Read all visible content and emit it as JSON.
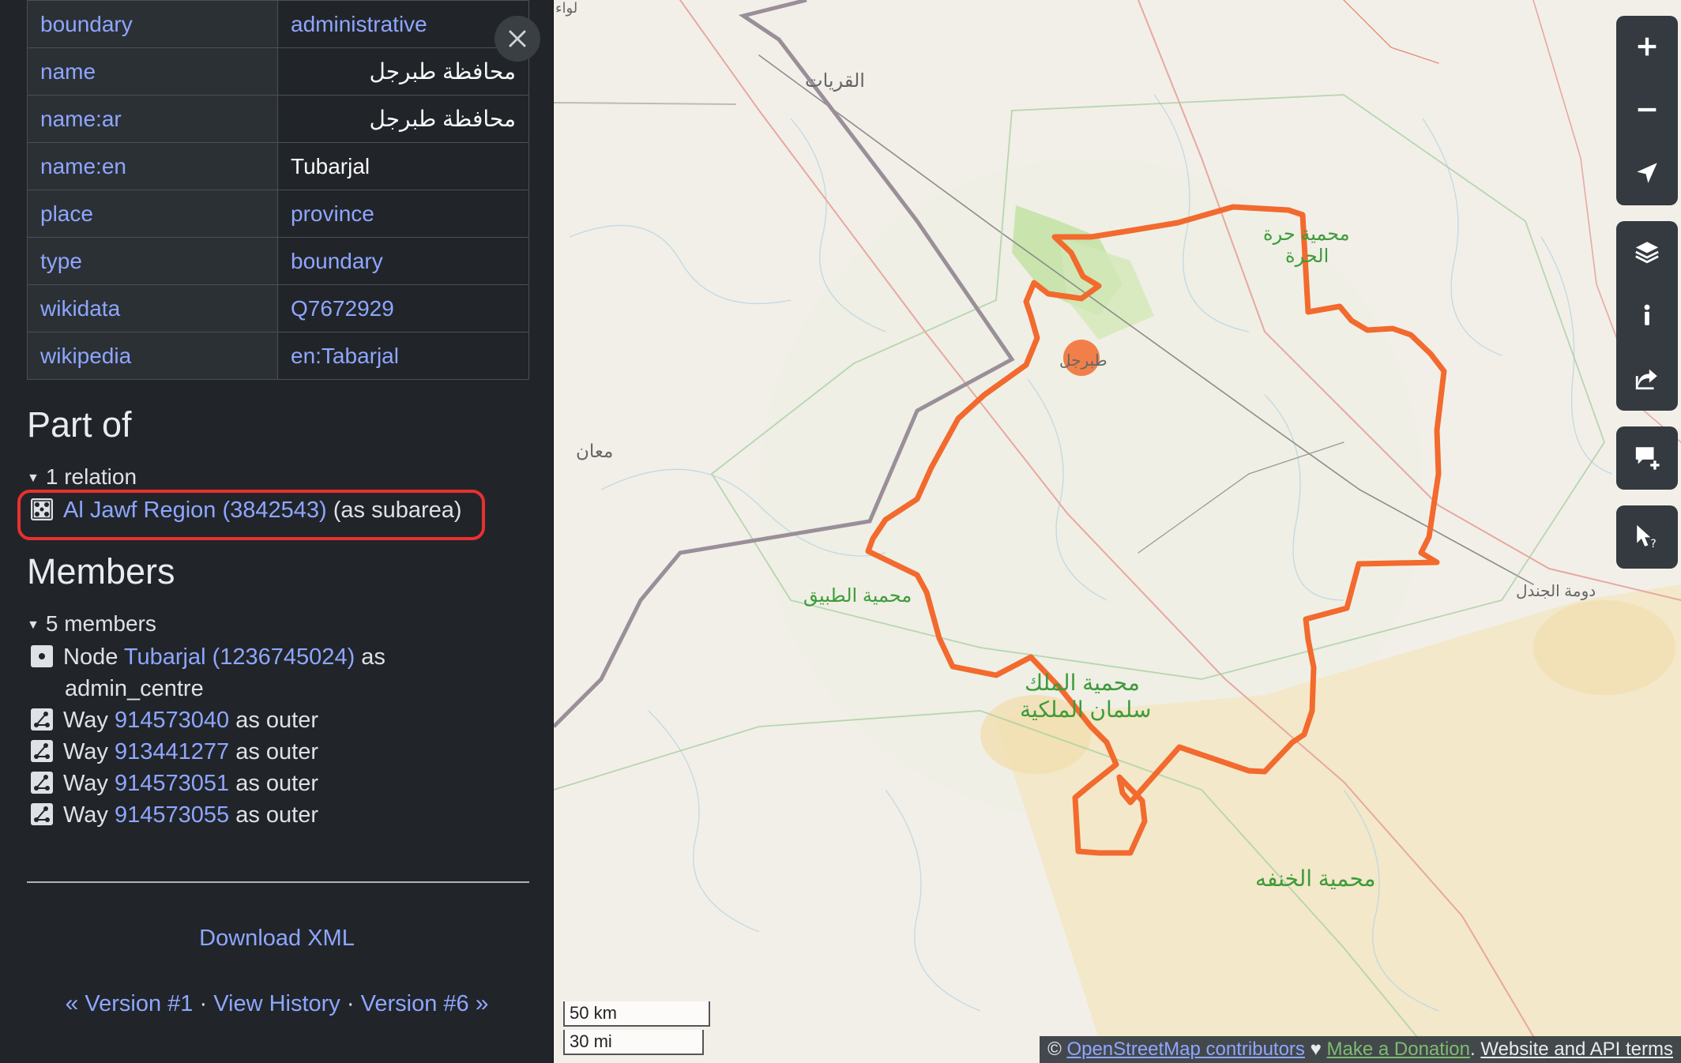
{
  "tags": [
    {
      "key": "boundary",
      "value": "administrative",
      "style": "link"
    },
    {
      "key": "name",
      "value": "محافظة طبرجل",
      "style": "rtl"
    },
    {
      "key": "name:ar",
      "value": "محافظة طبرجل",
      "style": "rtl"
    },
    {
      "key": "name:en",
      "value": "Tubarjal",
      "style": "plain"
    },
    {
      "key": "place",
      "value": "province",
      "style": "link"
    },
    {
      "key": "type",
      "value": "boundary",
      "style": "link"
    },
    {
      "key": "wikidata",
      "value": "Q7672929",
      "style": "link"
    },
    {
      "key": "wikipedia",
      "value": "en:Tabarjal",
      "style": "link"
    }
  ],
  "part_of": {
    "heading": "Part of",
    "summary": "1 relation",
    "relation_link": "Al Jawf Region (3842543)",
    "relation_suffix": "(as subarea)"
  },
  "members": {
    "heading": "Members",
    "summary": "5 members",
    "node": {
      "prefix": "Node",
      "link": "Tubarjal (1236745024)",
      "suffix": "as",
      "role": "admin_centre"
    },
    "ways": [
      {
        "prefix": "Way",
        "link": "914573040",
        "suffix": "as outer"
      },
      {
        "prefix": "Way",
        "link": "913441277",
        "suffix": "as outer"
      },
      {
        "prefix": "Way",
        "link": "914573051",
        "suffix": "as outer"
      },
      {
        "prefix": "Way",
        "link": "914573055",
        "suffix": "as outer"
      }
    ]
  },
  "download_label": "Download XML",
  "versions": {
    "prev_arrow": "«",
    "prev": "Version #1",
    "sep": "·",
    "history": "View History",
    "next": "Version #6",
    "next_arrow": "»"
  },
  "map": {
    "scale_km": "50 km",
    "scale_mi": "30 mi",
    "attribution": {
      "copyright": "© ",
      "osm": "OpenStreetMap contributors",
      "heart": " ♥ ",
      "donate": "Make a Donation",
      "dot": ". ",
      "terms": "Website and API terms"
    },
    "labels": {
      "qurayyat": "القريات",
      "maan": "معان",
      "tubarjal_town": "طبرجل",
      "harrat_1": "محمية حرة",
      "harrat_2": "الحرة",
      "tubaiq": "محمية الطبيق",
      "king_salman_1": "محمية الملك",
      "king_salman_2": "سلمان الملكية",
      "khunfah": "محمية الخنفه",
      "dumat": "دومة الجندل",
      "liwa": "لواء"
    },
    "boundary_color": "#f26a2e",
    "accent_green": "#3e9b3a"
  },
  "icons": {
    "close": "close-icon",
    "zoom_in": "plus-icon",
    "zoom_out": "minus-icon",
    "locate": "location-arrow-icon",
    "layers": "layers-icon",
    "info": "info-icon",
    "share": "share-icon",
    "note": "add-note-icon",
    "query": "query-features-icon"
  }
}
